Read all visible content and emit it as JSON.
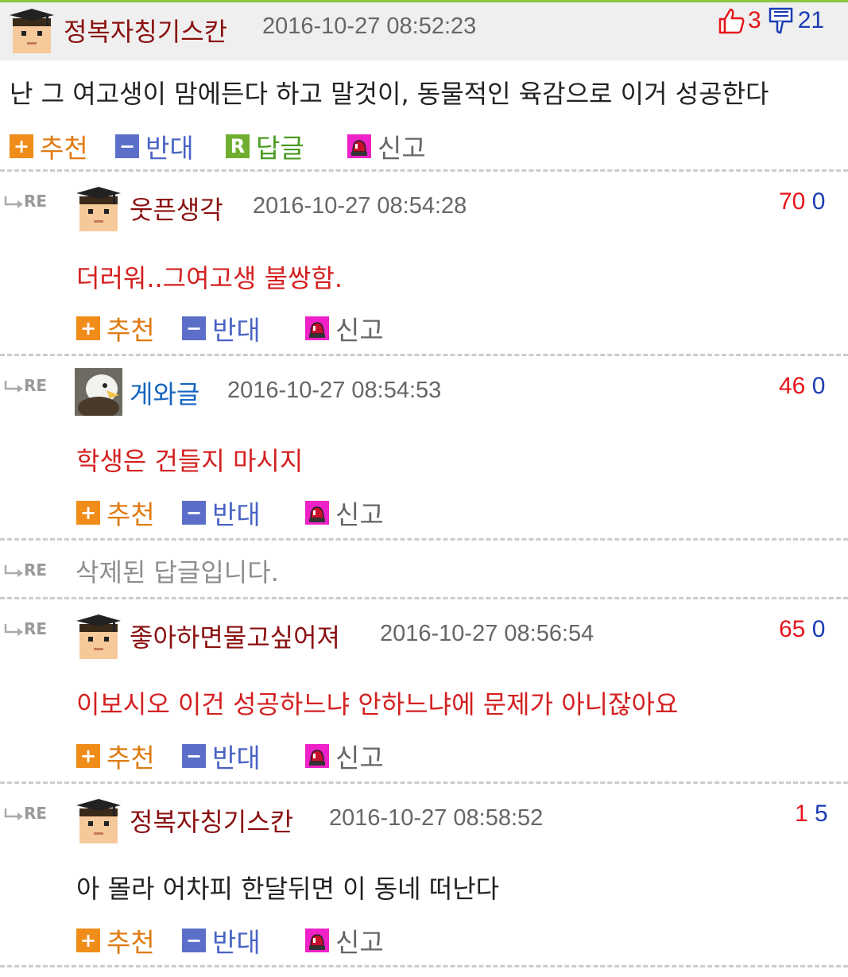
{
  "main": {
    "nickname": "정복자칭기스칸",
    "date": "2016-10-27 08:52:23",
    "up": "3",
    "down": "21",
    "text": "난 그 여고생이 맘에든다 하고 말것이, 동물적인 육감으로 이거 성공한다"
  },
  "actions": {
    "recommend": "추천",
    "oppose": "반대",
    "reply": "답글",
    "report": "신고",
    "re_label": "RE"
  },
  "comments": [
    {
      "nickname": "웃픈생각",
      "date": "2016-10-27 08:54:28",
      "up": "70",
      "down": "0",
      "text": "더러워..그여고생 불쌍함."
    },
    {
      "nickname": "게와글",
      "date": "2016-10-27 08:54:53",
      "up": "46",
      "down": "0",
      "text": "학생은 건들지 마시지"
    },
    {
      "deleted_text": "삭제된 답글입니다."
    },
    {
      "nickname": "좋아하면물고싶어져",
      "date": "2016-10-27 08:56:54",
      "up": "65",
      "down": "0",
      "text": "이보시오 이건 성공하느냐 안하느냐에 문제가 아니잖아요"
    },
    {
      "nickname": "정복자칭기스칸",
      "date": "2016-10-27 08:58:52",
      "up": "1",
      "down": "5",
      "text": "아 몰라 어차피 한달뒤면 이 동네 떠난다"
    }
  ],
  "icons": {
    "thumbs_up": "thumbs-up-icon",
    "thumbs_down": "thumbs-down-icon",
    "reply_arrow": "reply-arrow-icon",
    "plus": "plus-icon",
    "minus": "minus-icon",
    "report": "siren-icon"
  },
  "colors": {
    "up": "#e8151b",
    "down": "#1a3cb5",
    "accent_line": "#8cc63f"
  }
}
